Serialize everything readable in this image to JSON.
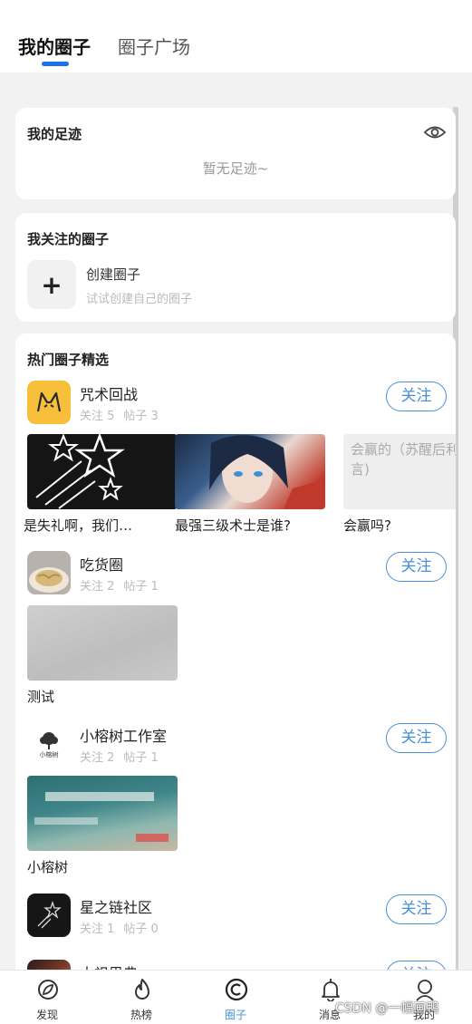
{
  "tabs": {
    "active": "我的圈子",
    "inactive": "圈子广场"
  },
  "footprint": {
    "title": "我的足迹",
    "empty": "暂无足迹~"
  },
  "followed": {
    "title": "我关注的圈子",
    "create_title": "创建圈子",
    "create_sub": "试试创建自己的圈子",
    "plus": "+"
  },
  "hot": {
    "title": "热门圈子精选",
    "follow_label": "关注",
    "circles": [
      {
        "name": "咒术回战",
        "follows": "关注 5",
        "posts": "帖子 3",
        "post_items": [
          {
            "caption": "是失礼啊，我们…"
          },
          {
            "caption": "最强三级术士是谁?"
          },
          {
            "caption": "会赢吗?",
            "image_text": "会赢的（苏醒后利宣言)"
          }
        ]
      },
      {
        "name": "吃货圈",
        "follows": "关注 2",
        "posts": "帖子 1",
        "post_items": [
          {
            "caption": "测试"
          }
        ]
      },
      {
        "name": "小榕树工作室",
        "follows": "关注 2",
        "posts": "帖子 1",
        "avatar_text": "小榕树",
        "post_items": [
          {
            "caption": "小榕树"
          }
        ]
      },
      {
        "name": "星之链社区",
        "follows": "关注 1",
        "posts": "帖子 0"
      },
      {
        "name": "大祖思典"
      }
    ]
  },
  "nav": [
    {
      "label": "发现",
      "icon": "leaf-icon"
    },
    {
      "label": "热榜",
      "icon": "fire-icon"
    },
    {
      "label": "圈子",
      "icon": "circle-icon",
      "active": true
    },
    {
      "label": "消息",
      "icon": "bell-icon"
    },
    {
      "label": "我的",
      "icon": "user-icon"
    }
  ],
  "watermark": "CSDN @一幅画鸭",
  "colors": {
    "accent": "#4a90d9",
    "tab_underline": "#1a73e8",
    "background": "#f2f2f2"
  }
}
